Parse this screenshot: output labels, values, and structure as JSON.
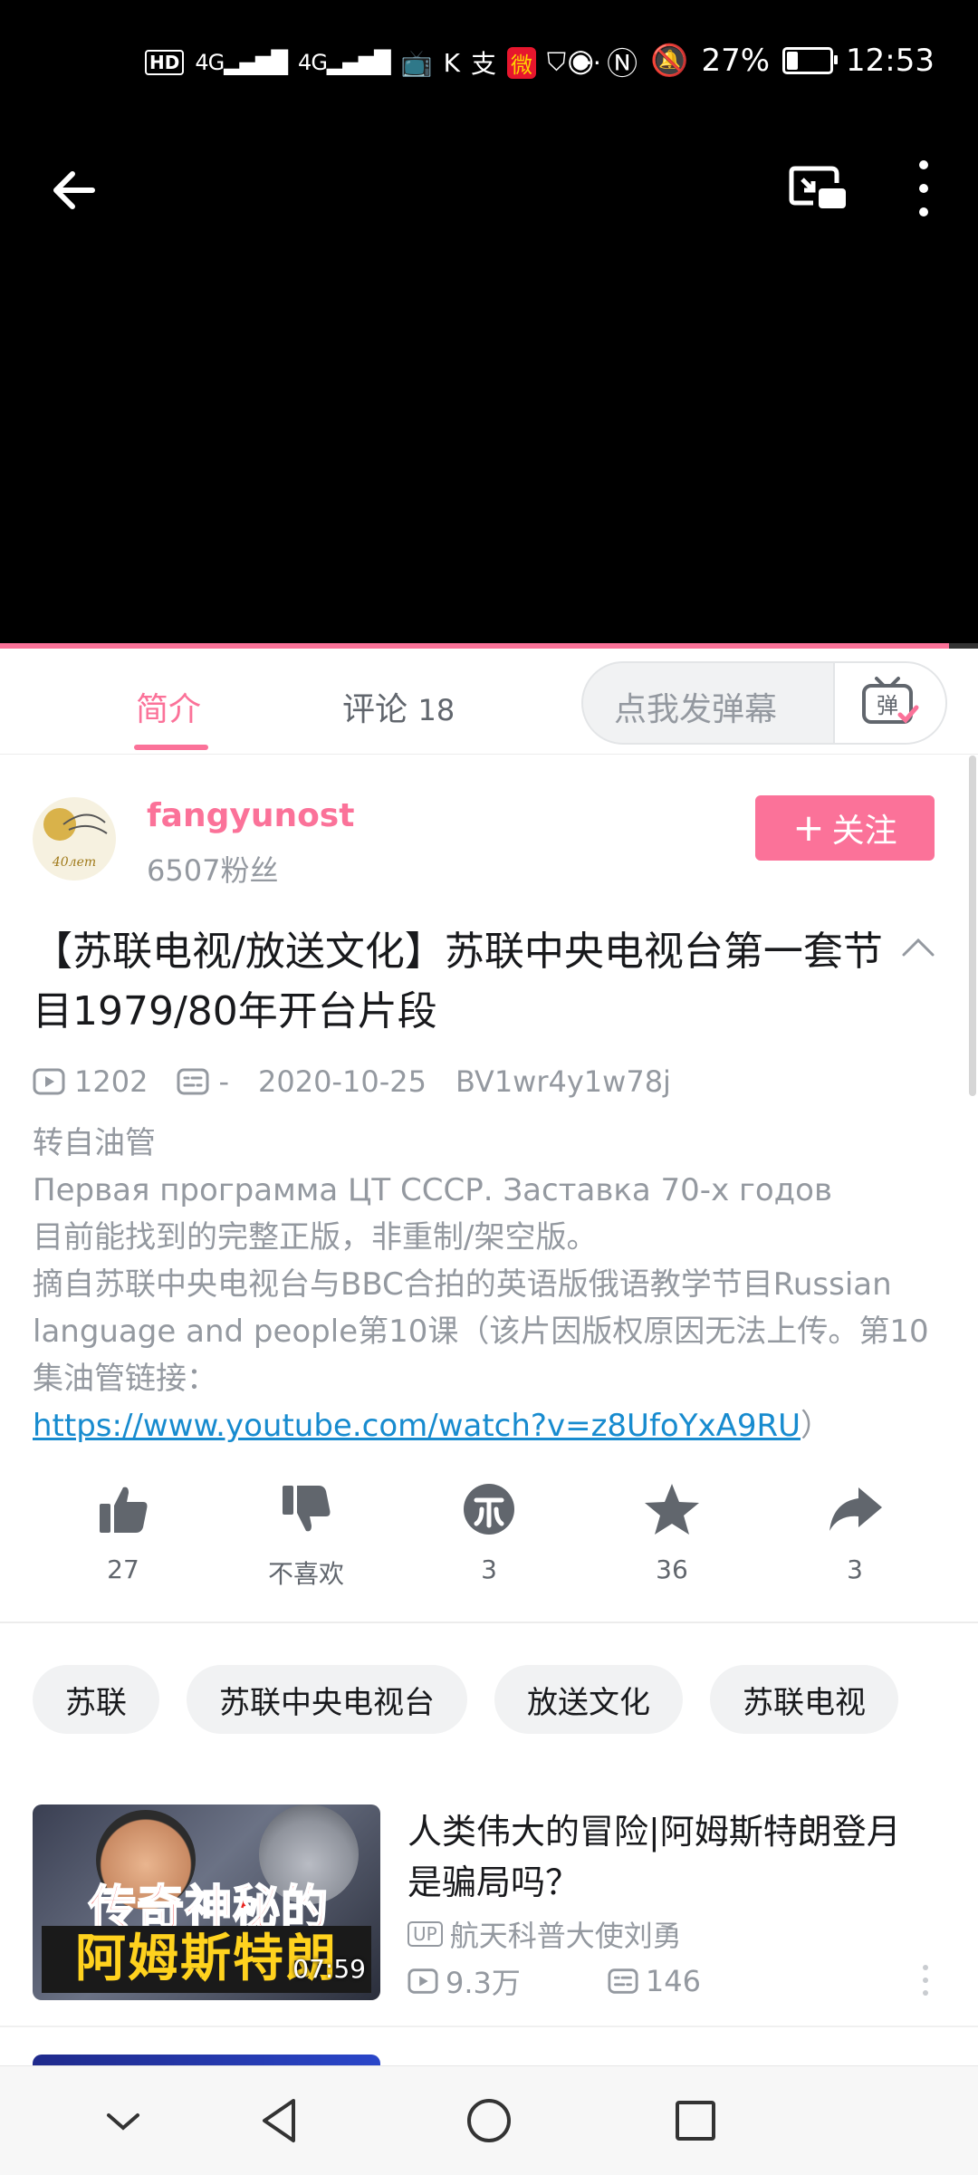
{
  "status_bar": {
    "hd": "HD",
    "net1": "4G",
    "net2": "4G",
    "more": "···",
    "battery_percent": "27%",
    "battery_level": 0.27,
    "time": "12:53"
  },
  "video": {
    "progress": 0.97
  },
  "tabs": {
    "intro": "简介",
    "comments_label": "评论",
    "comments_count": "18",
    "danmaku_placeholder": "点我发弹幕",
    "danmaku_button": "弹"
  },
  "uploader": {
    "name": "fangyunost",
    "fans": "6507粉丝",
    "avatar_text": "40лет",
    "follow_label": "关注"
  },
  "video_info": {
    "title": "【苏联电视/放送文化】苏联中央电视台第一套节目1979/80年开台片段",
    "views": "1202",
    "danmaku": "-",
    "date": "2020-10-25",
    "bvid": "BV1wr4y1w78j"
  },
  "description": {
    "line1": "转自油管",
    "line2": "Первая программа ЦТ СССР. Заставка 70-х годов",
    "line3": "目前能找到的完整正版，非重制/架空版。",
    "line4": "摘自苏联中央电视台与BBC合拍的英语版俄语教学节目Russian language and people第10课（该片因版权原因无法上传。第10集油管链接：",
    "link": "https://www.youtube.com/watch?v=z8UfoYxA9RU",
    "tail": "）"
  },
  "actions": {
    "like": "27",
    "dislike": "不喜欢",
    "coin": "3",
    "favorite": "36",
    "share": "3"
  },
  "tags": [
    "苏联",
    "苏联中央电视台",
    "放送文化",
    "苏联电视"
  ],
  "recommendation": {
    "title": "人类伟大的冒险|阿姆斯特朗登月是骗局吗？",
    "up_badge": "UP",
    "up_name": "航天科普大使刘勇",
    "views": "9.3万",
    "danmaku": "146",
    "duration": "07:59",
    "thumb_text_top": "传奇神秘的",
    "thumb_text_bottom": "阿姆斯特朗"
  },
  "colors": {
    "accent": "#fb7299",
    "link": "#178bcf"
  }
}
